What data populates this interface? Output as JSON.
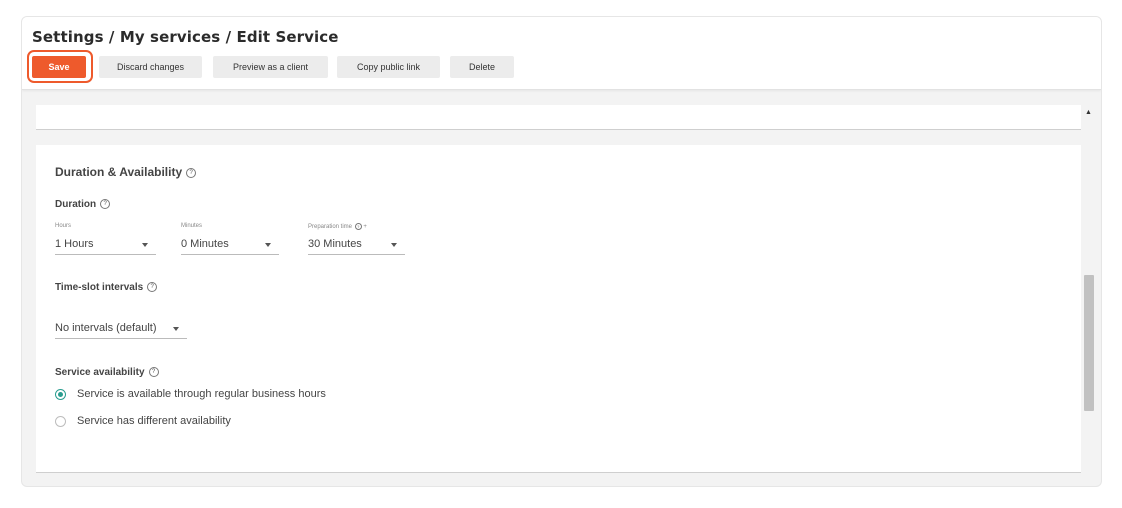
{
  "header": {
    "breadcrumb": "Settings / My services / Edit Service",
    "buttons": {
      "save": "Save",
      "discard": "Discard changes",
      "preview": "Preview as a client",
      "copy_link": "Copy public link",
      "delete": "Delete"
    }
  },
  "duration_section": {
    "title": "Duration & Availability",
    "duration_label": "Duration",
    "hours_label": "Hours",
    "hours_value": "1 Hours",
    "minutes_label": "Minutes",
    "minutes_value": "0 Minutes",
    "prep_label": "Preparation time",
    "prep_value": "30 Minutes",
    "interval_label": "Time-slot intervals",
    "interval_value": "No intervals (default)",
    "availability_label": "Service availability",
    "options": [
      "Service is available through regular business hours",
      "Service has different availability"
    ]
  },
  "icons": {
    "help": "?",
    "add": "+"
  },
  "colors": {
    "accent": "#ee5a2c",
    "radio_checked": "#2a9d8f"
  }
}
